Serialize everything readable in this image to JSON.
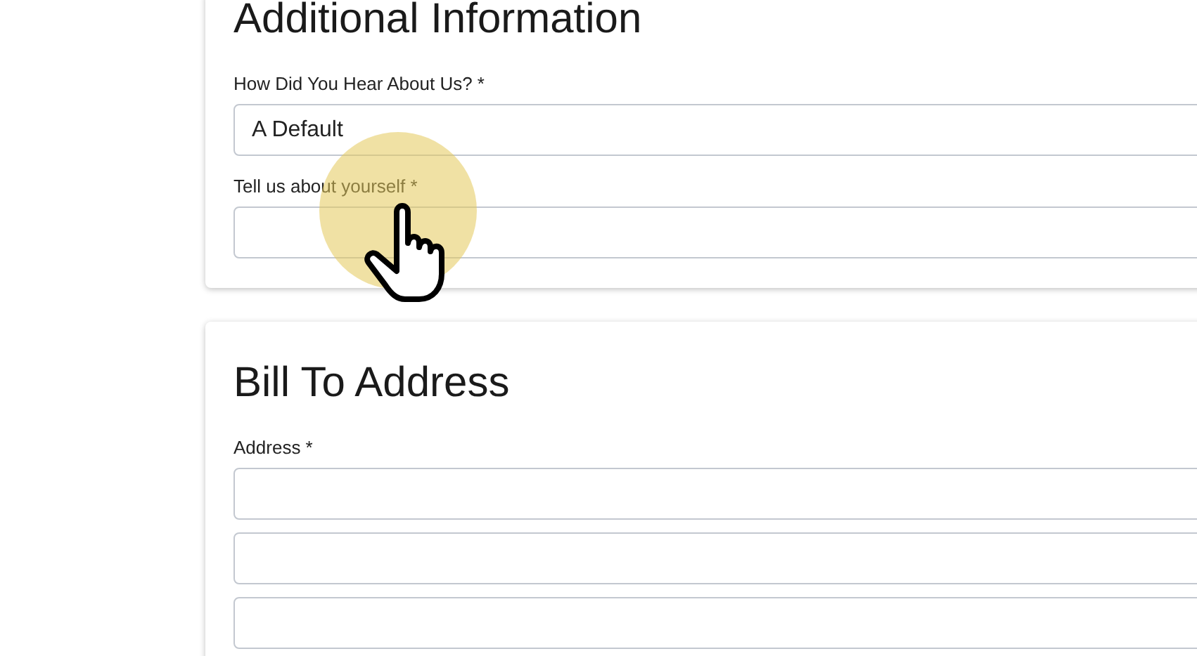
{
  "sections": [
    {
      "title": "Additional Information",
      "fields": [
        {
          "kind": "labeled",
          "label": "How Did You Hear About Us? *",
          "value": "A Default"
        },
        {
          "kind": "labeled",
          "label": "Tell us about yourself *"
        }
      ]
    },
    {
      "title": "Bill To Address",
      "fields": [
        {
          "kind": "labeled",
          "label": "Address *"
        },
        {
          "kind": "line"
        },
        {
          "kind": "line"
        }
      ]
    }
  ]
}
